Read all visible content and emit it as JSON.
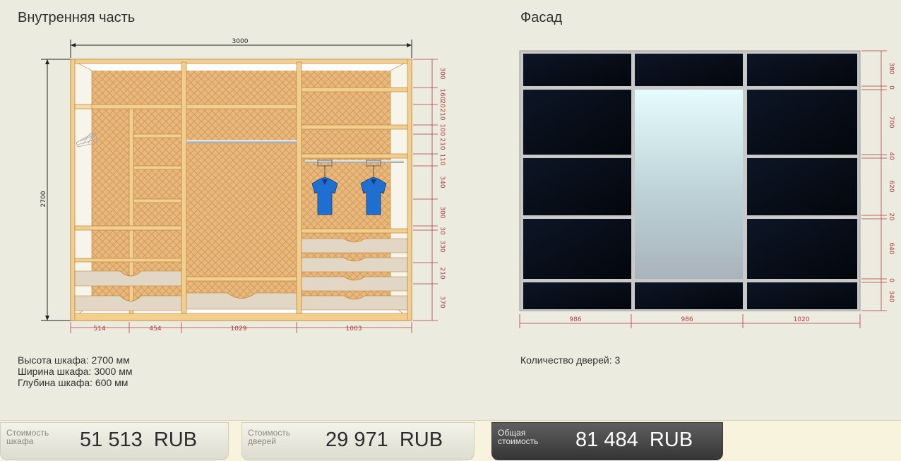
{
  "interior": {
    "title": "Внутренняя часть",
    "overall_width": "3000",
    "overall_height": "2700",
    "bottom_dims": [
      "514",
      "454",
      "1029",
      "1003"
    ],
    "right_dims": [
      "300",
      "160",
      "20",
      "210",
      "100",
      "210",
      "110",
      "340",
      "300",
      "30",
      "330",
      "210",
      "370"
    ],
    "info": {
      "height": "Высота шкафа: 2700 мм",
      "width": "Ширина шкафа: 3000 мм",
      "depth": "Глубина шкафа: 600 мм"
    }
  },
  "facade": {
    "title": "Фасад",
    "bottom_dims": [
      "986",
      "986",
      "1020"
    ],
    "right_dims": [
      "380",
      "0",
      "700",
      "40",
      "620",
      "20",
      "640",
      "0",
      "340"
    ],
    "info": {
      "doors": "Количество дверей: 3"
    }
  },
  "costs": {
    "cabinet": {
      "label_1": "Стоимость",
      "label_2": "шкафа",
      "value": "51 513  RUB"
    },
    "doors": {
      "label_1": "Стоимость",
      "label_2": "дверей",
      "value": "29 971  RUB"
    },
    "total": {
      "label_1": "Общая",
      "label_2": "стоимость",
      "value": "81 484  RUB"
    }
  },
  "colors": {
    "wood_frame": "#f2cf8e",
    "back_panel": "#e8b77a",
    "dimension": "#b13c3c",
    "glass": "#0a0f1a",
    "mirror": "#cfe7ea",
    "shirt": "#1f6fd1"
  }
}
